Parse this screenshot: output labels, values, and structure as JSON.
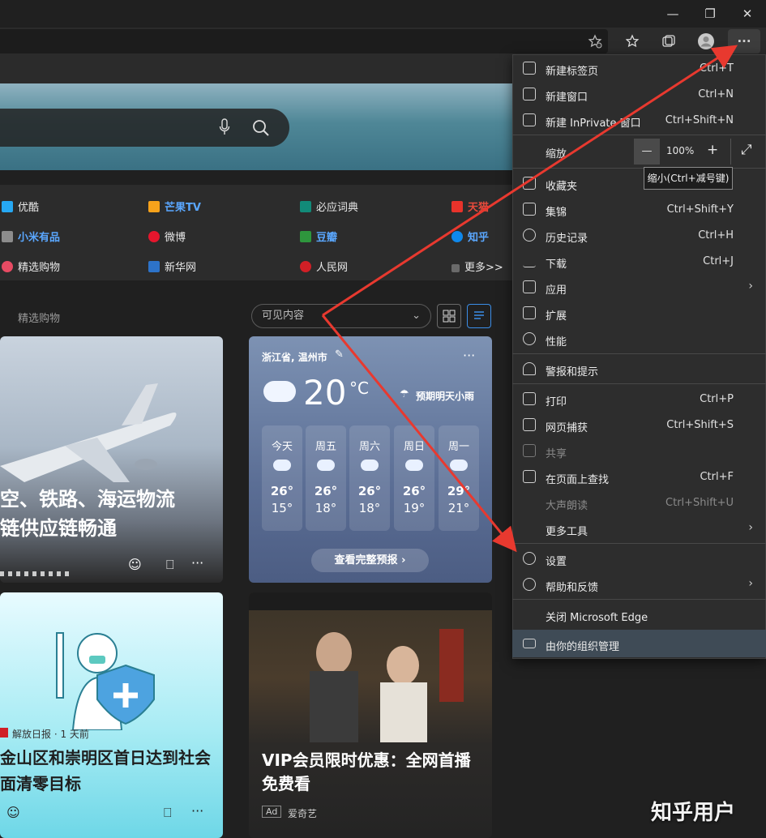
{
  "window": {
    "minimize": "—",
    "restore": "❐",
    "close": "✕"
  },
  "toolbar": {
    "favorites_add_icon": "star-plus-icon",
    "favorites_icon": "star-list-icon",
    "collections_icon": "collections-icon",
    "profile_icon": "avatar",
    "more_icon": "···"
  },
  "quicklinks": [
    {
      "label": "优酷",
      "style": "normal",
      "color": "#26a8f3"
    },
    {
      "label": "芒果TV",
      "style": "blue",
      "color": "#f7a21b"
    },
    {
      "label": "必应词典",
      "style": "normal",
      "color": "#128b79"
    },
    {
      "label": "天猫",
      "style": "red",
      "color": "#e8332b"
    },
    {
      "label": "小米有品",
      "style": "blue",
      "color": "#8c8c8c"
    },
    {
      "label": "微博",
      "style": "normal",
      "color": "#e6162d"
    },
    {
      "label": "豆瓣",
      "style": "blue",
      "color": "#2e963d"
    },
    {
      "label": "知乎",
      "style": "blue",
      "color": "#0f88eb"
    },
    {
      "label": "精选购物",
      "style": "normal",
      "color": "#e84b63"
    },
    {
      "label": "新华网",
      "style": "normal",
      "color": "#2d73c9"
    },
    {
      "label": "人民网",
      "style": "normal",
      "color": "#d11f26"
    },
    {
      "label": "更多>>",
      "style": "normal",
      "color": "#8a8a8a"
    }
  ],
  "feed": {
    "section_label": "精选购物",
    "visible_select": "可见内容"
  },
  "news1": {
    "headline_line1": "空、铁路、海运物流",
    "headline_line2": "链供应链畅通"
  },
  "weather": {
    "location": "浙江省, 温州市",
    "temp": "20",
    "unit": "°C",
    "forecast_note": "预期明天小雨",
    "more": "···",
    "days": [
      {
        "name": "今天",
        "hi": "26°",
        "lo": "15°"
      },
      {
        "name": "周五",
        "hi": "26°",
        "lo": "18°"
      },
      {
        "name": "周六",
        "hi": "26°",
        "lo": "18°"
      },
      {
        "name": "周日",
        "hi": "26°",
        "lo": "19°"
      },
      {
        "name": "周一",
        "hi": "29°",
        "lo": "21°"
      }
    ],
    "full_forecast": "查看完整预报 ›"
  },
  "news2": {
    "source": "解放日报 · 1 天前",
    "headline_line1": "金山区和崇明区首日达到社会",
    "headline_line2": "面清零目标"
  },
  "news3": {
    "headline_line1": "VIP会员限时优惠：全网首播",
    "headline_line2": "免费看",
    "ad_label": "Ad",
    "advertiser": "爱奇艺"
  },
  "menu": {
    "items": [
      {
        "label": "新建标签页",
        "shortcut": "Ctrl+T"
      },
      {
        "label": "新建窗口",
        "shortcut": "Ctrl+N"
      },
      {
        "label": "新建 InPrivate 窗口",
        "shortcut": "Ctrl+Shift+N"
      },
      {
        "label": "收藏夹",
        "shortcut": ""
      },
      {
        "label": "集锦",
        "shortcut": "Ctrl+Shift+Y"
      },
      {
        "label": "历史记录",
        "shortcut": "Ctrl+H"
      },
      {
        "label": "下载",
        "shortcut": "Ctrl+J"
      },
      {
        "label": "应用",
        "shortcut": ""
      },
      {
        "label": "扩展",
        "shortcut": ""
      },
      {
        "label": "性能",
        "shortcut": ""
      },
      {
        "label": "警报和提示",
        "shortcut": ""
      },
      {
        "label": "打印",
        "shortcut": "Ctrl+P"
      },
      {
        "label": "网页捕获",
        "shortcut": "Ctrl+Shift+S"
      },
      {
        "label": "共享",
        "shortcut": ""
      },
      {
        "label": "在页面上查找",
        "shortcut": "Ctrl+F"
      },
      {
        "label": "大声朗读",
        "shortcut": "Ctrl+Shift+U"
      },
      {
        "label": "更多工具",
        "shortcut": ""
      },
      {
        "label": "设置",
        "shortcut": ""
      },
      {
        "label": "帮助和反馈",
        "shortcut": ""
      },
      {
        "label": "关闭 Microsoft Edge",
        "shortcut": ""
      },
      {
        "label": "由你的组织管理",
        "shortcut": ""
      }
    ],
    "zoom": {
      "label": "缩放",
      "minus": "—",
      "value": "100%",
      "plus": "+",
      "fullscreen": "⤢"
    },
    "tooltip": "缩小(Ctrl+减号键)"
  },
  "watermark": "知乎用户",
  "annotation_color": "#e8392f"
}
